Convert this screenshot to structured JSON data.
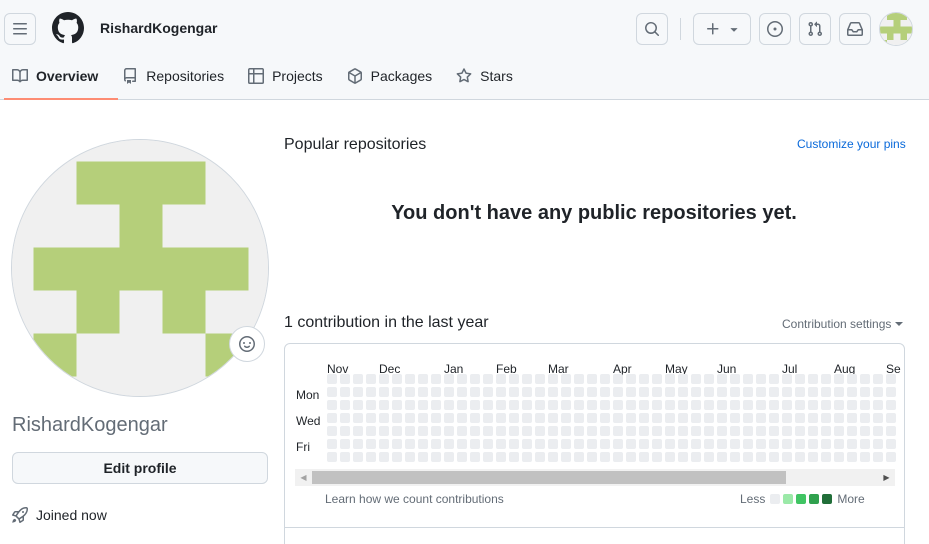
{
  "header": {
    "username": "RishardKogengar",
    "avatar_color": "#b5cf7a"
  },
  "tabs": [
    {
      "label": "Overview",
      "icon": "book-icon",
      "selected": true
    },
    {
      "label": "Repositories",
      "icon": "repo-icon",
      "selected": false
    },
    {
      "label": "Projects",
      "icon": "table-icon",
      "selected": false
    },
    {
      "label": "Packages",
      "icon": "package-icon",
      "selected": false
    },
    {
      "label": "Stars",
      "icon": "star-icon",
      "selected": false
    }
  ],
  "profile": {
    "name": "RishardKogengar",
    "edit_label": "Edit profile",
    "joined": "Joined now"
  },
  "popular": {
    "title": "Popular repositories",
    "customize": "Customize your pins",
    "empty": "You don't have any public repositories yet."
  },
  "contributions": {
    "title": "1 contribution in the last year",
    "settings": "Contribution settings",
    "months": [
      "Nov",
      "Dec",
      "Jan",
      "Feb",
      "Mar",
      "Apr",
      "May",
      "Jun",
      "Jul",
      "Aug",
      "Se"
    ],
    "days": [
      "Mon",
      "Wed",
      "Fri"
    ],
    "learn": "Learn how we count contributions",
    "less": "Less",
    "more": "More",
    "empty_color": "#ebedf0",
    "legend_colors": [
      "#ebedf0",
      "#9be9a8",
      "#40c463",
      "#30a14e",
      "#216e39"
    ]
  }
}
